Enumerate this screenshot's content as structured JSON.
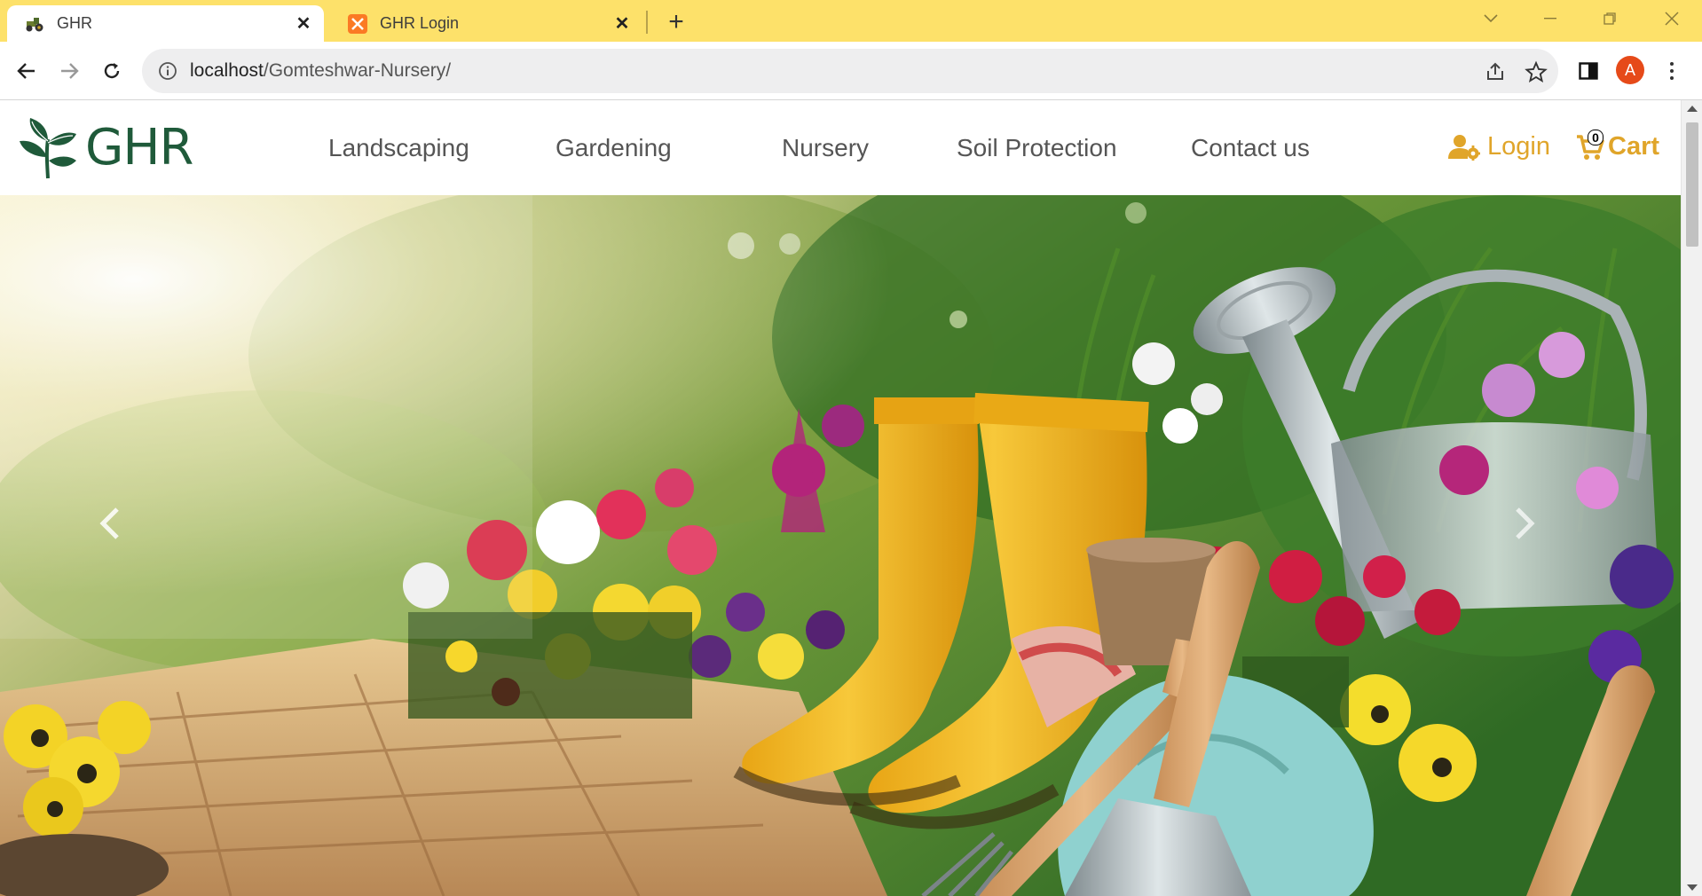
{
  "browser": {
    "tabs": [
      {
        "title": "GHR",
        "icon": "tractor-favicon-icon",
        "active": true
      },
      {
        "title": "GHR Login",
        "icon": "xampp-favicon-icon",
        "active": false
      }
    ],
    "url": {
      "host": "localhost",
      "path": "/Gomteshwar-Nursery/"
    },
    "profile_initial": "A",
    "colors": {
      "tabstrip": "#fde16a",
      "avatar": "#e64a19"
    }
  },
  "site": {
    "logo_text": "GHR",
    "nav": [
      "Landscaping",
      "Gardening",
      "Nursery",
      "Soil Protection",
      "Contact us"
    ],
    "login_label": "Login",
    "cart_label": "Cart",
    "cart_count": "0",
    "colors": {
      "brand_green": "#1f5a3a",
      "accent": "#e0a52a",
      "nav_text": "#555555"
    }
  },
  "hero": {
    "image": "garden-boots-flowers-hero-image",
    "prev_icon": "chevron-left-icon",
    "next_icon": "chevron-right-icon"
  }
}
